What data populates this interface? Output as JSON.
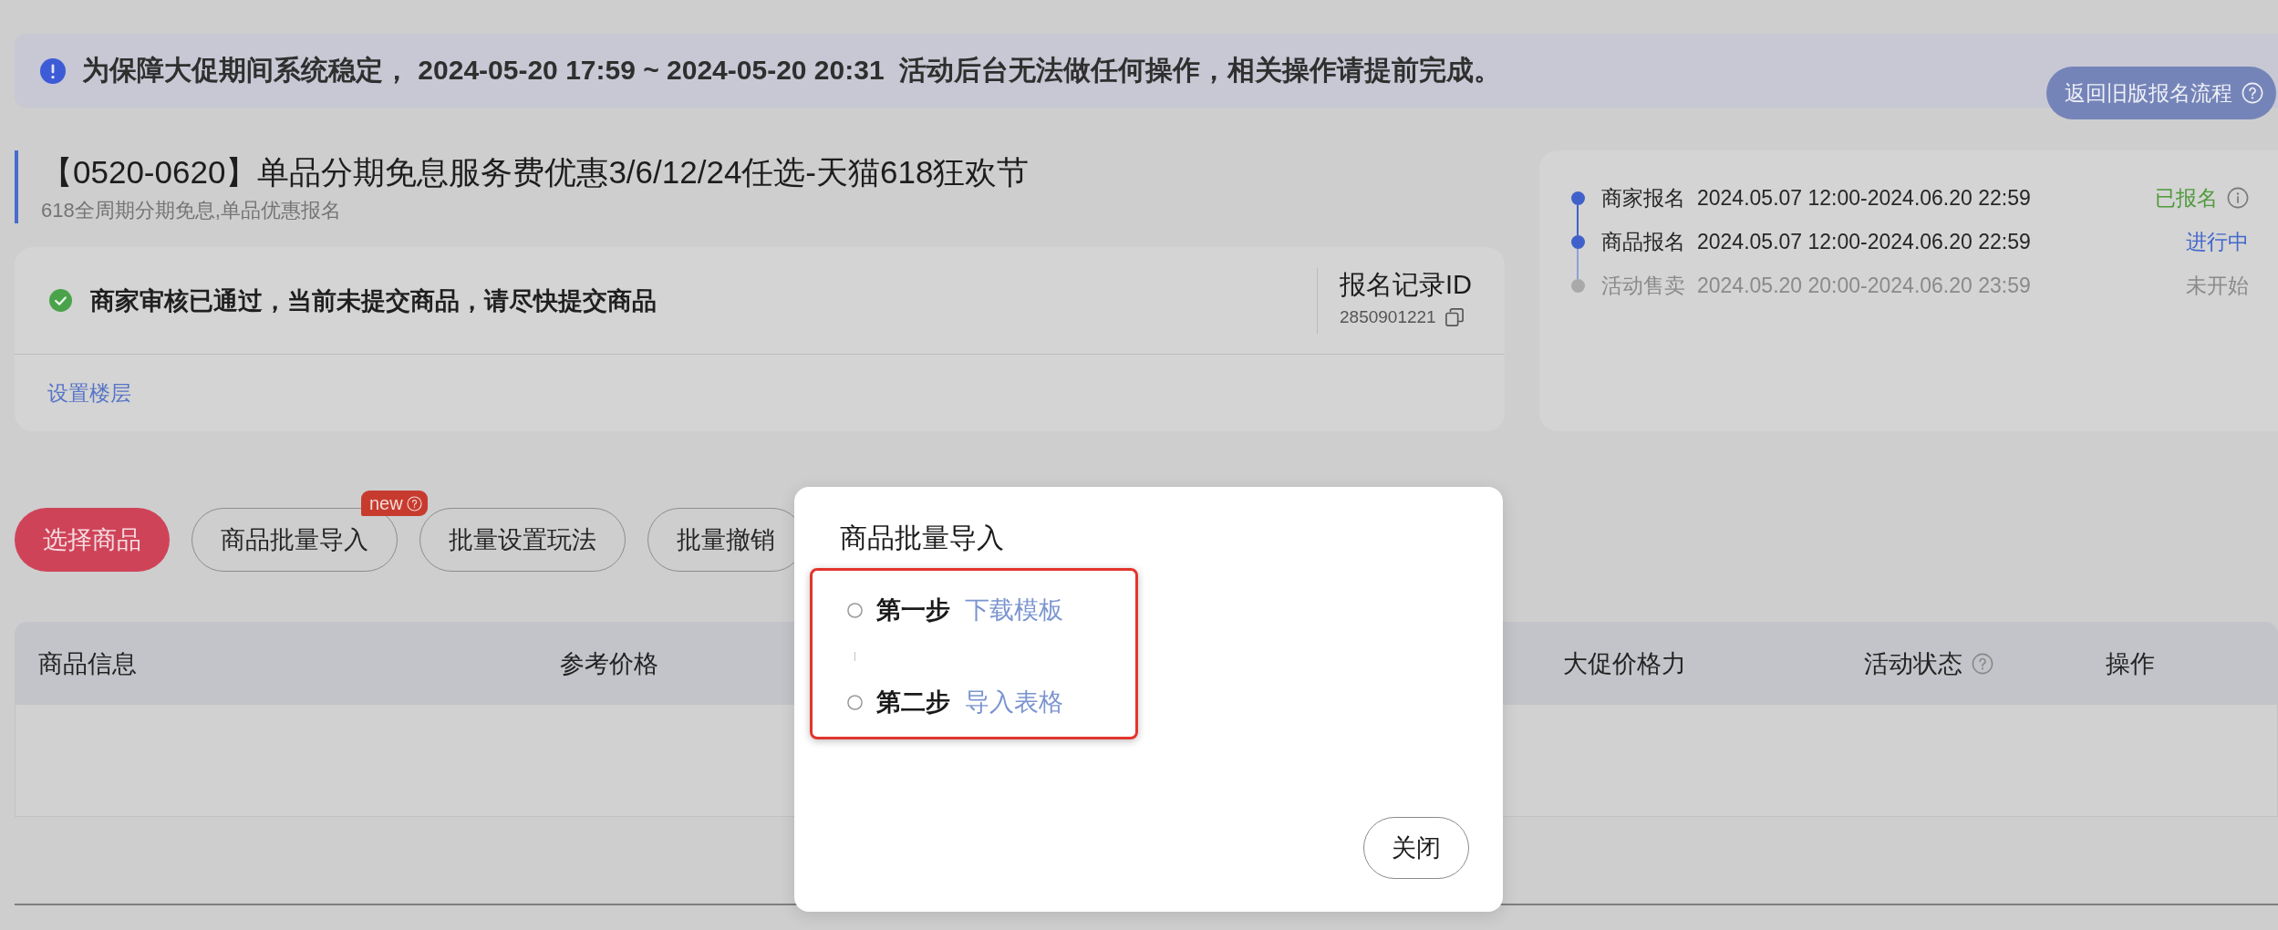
{
  "notice": {
    "text": "为保障大促期间系统稳定， 2024-05-20 17:59 ~ 2024-05-20 20:31  活动后台无法做任何操作，相关操作请提前完成。"
  },
  "legacy_button": {
    "label": "返回旧版报名流程"
  },
  "activity": {
    "title": "【0520-0620】单品分期免息服务费优惠3/6/12/24任选-天猫618狂欢节",
    "subtitle": "618全周期分期免息,单品优惠报名"
  },
  "review": {
    "message": "商家审核已通过，当前未提交商品，请尽快提交商品",
    "record_label": "报名记录ID",
    "record_id": "2850901221",
    "floor_link": "设置楼层"
  },
  "timeline": [
    {
      "label": "商家报名",
      "period": "2024.05.07 12:00-2024.06.20 22:59",
      "status": "已报名",
      "kind": "done",
      "info": true
    },
    {
      "label": "商品报名",
      "period": "2024.05.07 12:00-2024.06.20 22:59",
      "status": "进行中",
      "kind": "active"
    },
    {
      "label": "活动售卖",
      "period": "2024.05.20 20:00-2024.06.20 23:59",
      "status": "未开始",
      "kind": "pending"
    }
  ],
  "actions": [
    {
      "label": "选择商品",
      "kind": "primary"
    },
    {
      "label": "商品批量导入",
      "kind": "outline",
      "badge": "new"
    },
    {
      "label": "批量设置玩法",
      "kind": "outline"
    },
    {
      "label": "批量撤销",
      "kind": "outline"
    }
  ],
  "table": {
    "columns": [
      {
        "label": "商品信息"
      },
      {
        "label": "参考价格"
      },
      {
        "label": "大促价格力"
      },
      {
        "label": "活动状态",
        "help": true
      },
      {
        "label": "操作"
      }
    ]
  },
  "dialog": {
    "title": "商品批量导入",
    "highlighted": true,
    "steps": [
      {
        "label": "第一步",
        "link": "下载模板"
      },
      {
        "label": "第二步",
        "link": "导入表格"
      }
    ],
    "close": "关闭"
  }
}
